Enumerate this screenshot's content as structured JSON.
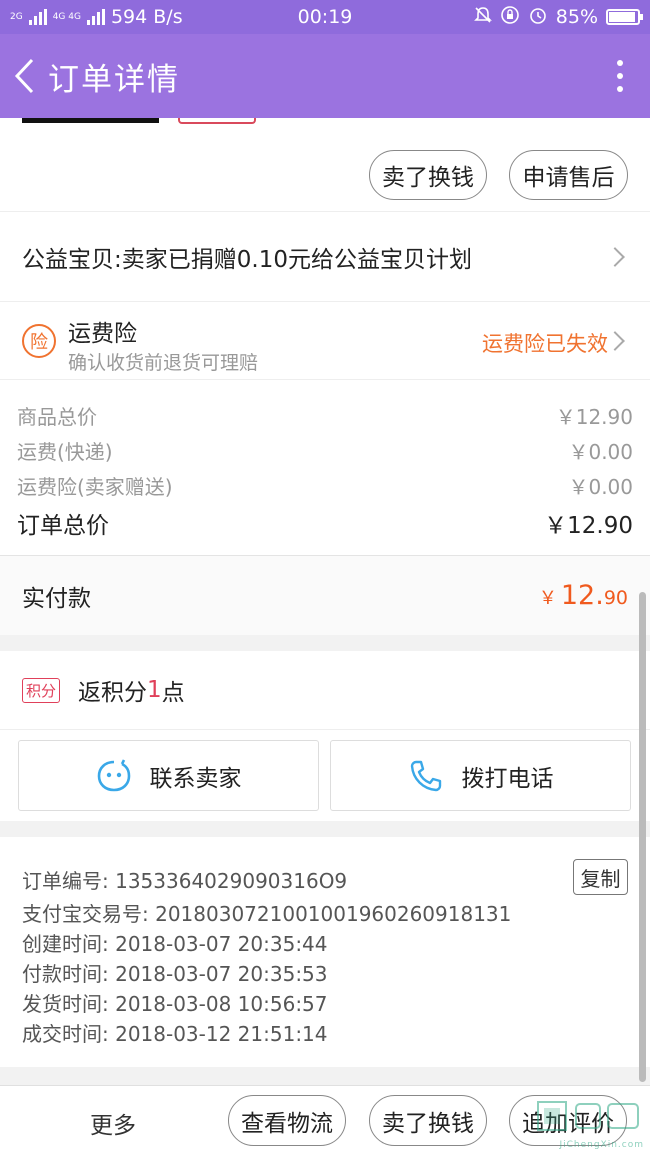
{
  "status_bar": {
    "network_left": "2G",
    "network_mid": "4G 4G",
    "speed": "594 B/s",
    "time": "00:19",
    "battery": "85%",
    "battery_fraction": 0.85
  },
  "header": {
    "title": "订单详情"
  },
  "top_actions": {
    "sell_label": "卖了换钱",
    "after_sale_label": "申请售后"
  },
  "charity": {
    "text": "公益宝贝:卖家已捐赠0.10元给公益宝贝计划"
  },
  "insurance": {
    "icon_char": "险",
    "title": "运费险",
    "subtitle": "确认收货前退货可理赔",
    "status": "运费险已失效",
    "status_color": "#f07330"
  },
  "prices": {
    "rows": [
      {
        "label": "商品总价",
        "value": "￥12.90"
      },
      {
        "label": "运费(快递)",
        "value": "￥0.00"
      },
      {
        "label": "运费险(卖家赠送)",
        "value": "￥0.00"
      }
    ],
    "total_label": "订单总价",
    "total_value": "￥12.90"
  },
  "paid": {
    "label": "实付款",
    "currency": "￥",
    "integer": "12.",
    "decimal": "90",
    "color": "#f05a1e"
  },
  "points": {
    "badge": "积分",
    "prefix": "返积分",
    "number": "1",
    "suffix": "点"
  },
  "contact": {
    "seller_label": "联系卖家",
    "phone_label": "拨打电话",
    "icon_color": "#3aa8e8"
  },
  "order_info": {
    "copy_label": "复制",
    "rows": [
      "订单编号: 1353364029090316O9",
      "支付宝交易号: 2018030721001001960260918131",
      "创建时间: 2018-03-07 20:35:44",
      "付款时间: 2018-03-07 20:35:53",
      "发货时间: 2018-03-08 10:56:57",
      "成交时间: 2018-03-12 21:51:14"
    ]
  },
  "bottom_bar": {
    "more_label": "更多",
    "logistics_label": "查看物流",
    "sell_label": "卖了换钱",
    "review_label": "追加评价",
    "watermark_url": "JiChengXin.com"
  },
  "colors": {
    "header": "#9b73e0",
    "accent_orange": "#f07330",
    "points_red": "#e0405a"
  }
}
